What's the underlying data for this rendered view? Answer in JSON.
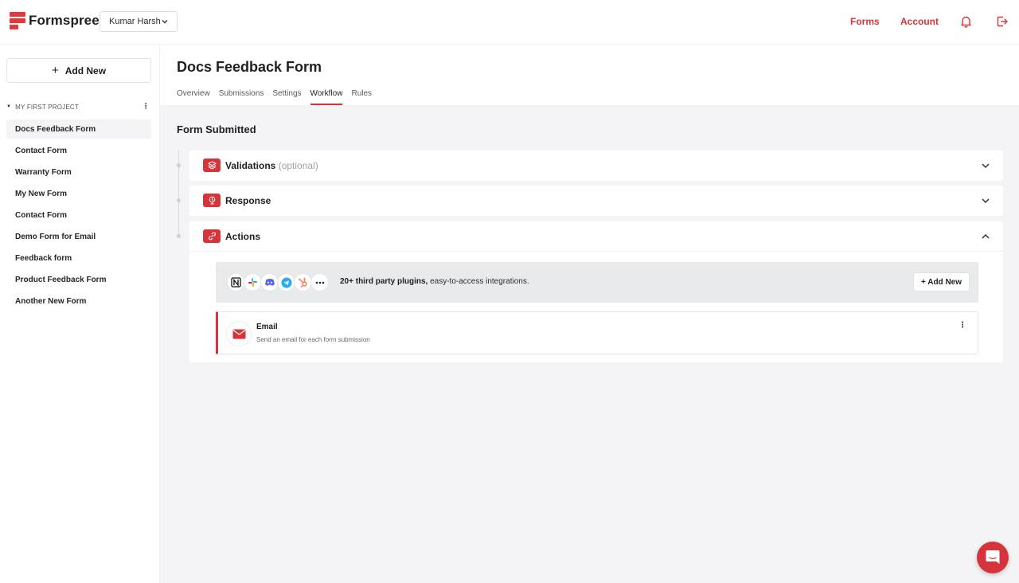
{
  "brand": {
    "name": "Formspree",
    "accent": "#d6343a"
  },
  "header": {
    "user_select": "Kumar Harsh",
    "nav": {
      "forms": "Forms",
      "account": "Account"
    }
  },
  "sidebar": {
    "add_new": "Add New",
    "project": "MY FIRST PROJECT",
    "forms": [
      "Docs Feedback Form",
      "Contact Form",
      "Warranty Form",
      "My New Form",
      "Contact Form",
      "Demo Form for Email",
      "Feedback form",
      "Product Feedback Form",
      "Another New Form"
    ],
    "active_index": 0
  },
  "main": {
    "title": "Docs Feedback Form",
    "tabs": [
      "Overview",
      "Submissions",
      "Settings",
      "Workflow",
      "Rules"
    ],
    "active_tab": "Workflow",
    "section_title": "Form Submitted",
    "steps": {
      "validations": {
        "label": "Validations",
        "optional": "(optional)"
      },
      "response": {
        "label": "Response"
      },
      "actions": {
        "label": "Actions"
      }
    },
    "plugins": {
      "icons": [
        "notion-icon",
        "slack-icon",
        "discord-icon",
        "telegram-icon",
        "hubspot-icon",
        "more-icon"
      ],
      "bold_text": "20+ third party plugins,",
      "text": " easy-to-access integrations.",
      "add_button": "+ Add New"
    },
    "email_action": {
      "title": "Email",
      "description": "Send an email for each form submission"
    }
  }
}
